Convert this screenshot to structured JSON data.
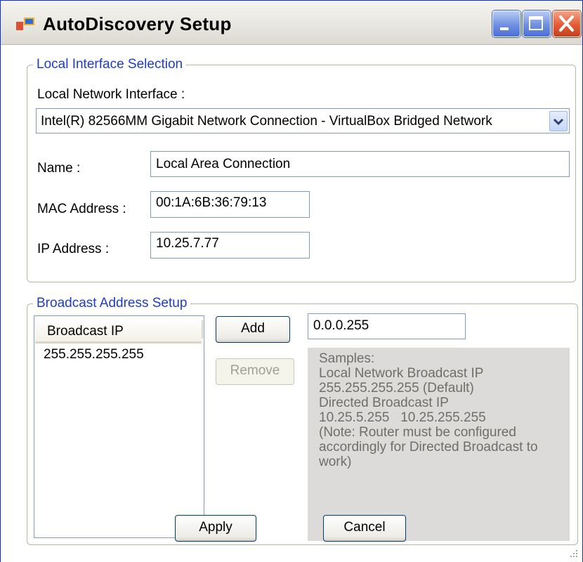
{
  "window": {
    "title": "AutoDiscovery Setup",
    "accent": "#0831d9"
  },
  "local_interface": {
    "group_label": "Local Interface Selection",
    "network_interface_label": "Local Network Interface :",
    "network_interface_value": "Intel(R) 82566MM Gigabit Network Connection - VirtualBox Bridged Network",
    "name_label": "Name :",
    "name_value": "Local Area Connection",
    "mac_label": "MAC Address :",
    "mac_value": "00:1A:6B:36:79:13",
    "ip_label": "IP Address :",
    "ip_value": "10.25.7.77"
  },
  "broadcast": {
    "group_label": "Broadcast Address Setup",
    "column_header": "Broadcast IP",
    "items": [
      "255.255.255.255"
    ],
    "add_label": "Add",
    "remove_label": "Remove",
    "input_value": "0.0.0.255",
    "samples": [
      "Samples:",
      "Local Network Broadcast IP",
      "255.255.255.255 (Default)",
      "Directed Broadcast IP",
      "10.25.5.255   10.25.255.255",
      "(Note: Router must be configured",
      "accordingly for Directed Broadcast to",
      "work)"
    ]
  },
  "footer": {
    "apply_label": "Apply",
    "cancel_label": "Cancel"
  }
}
